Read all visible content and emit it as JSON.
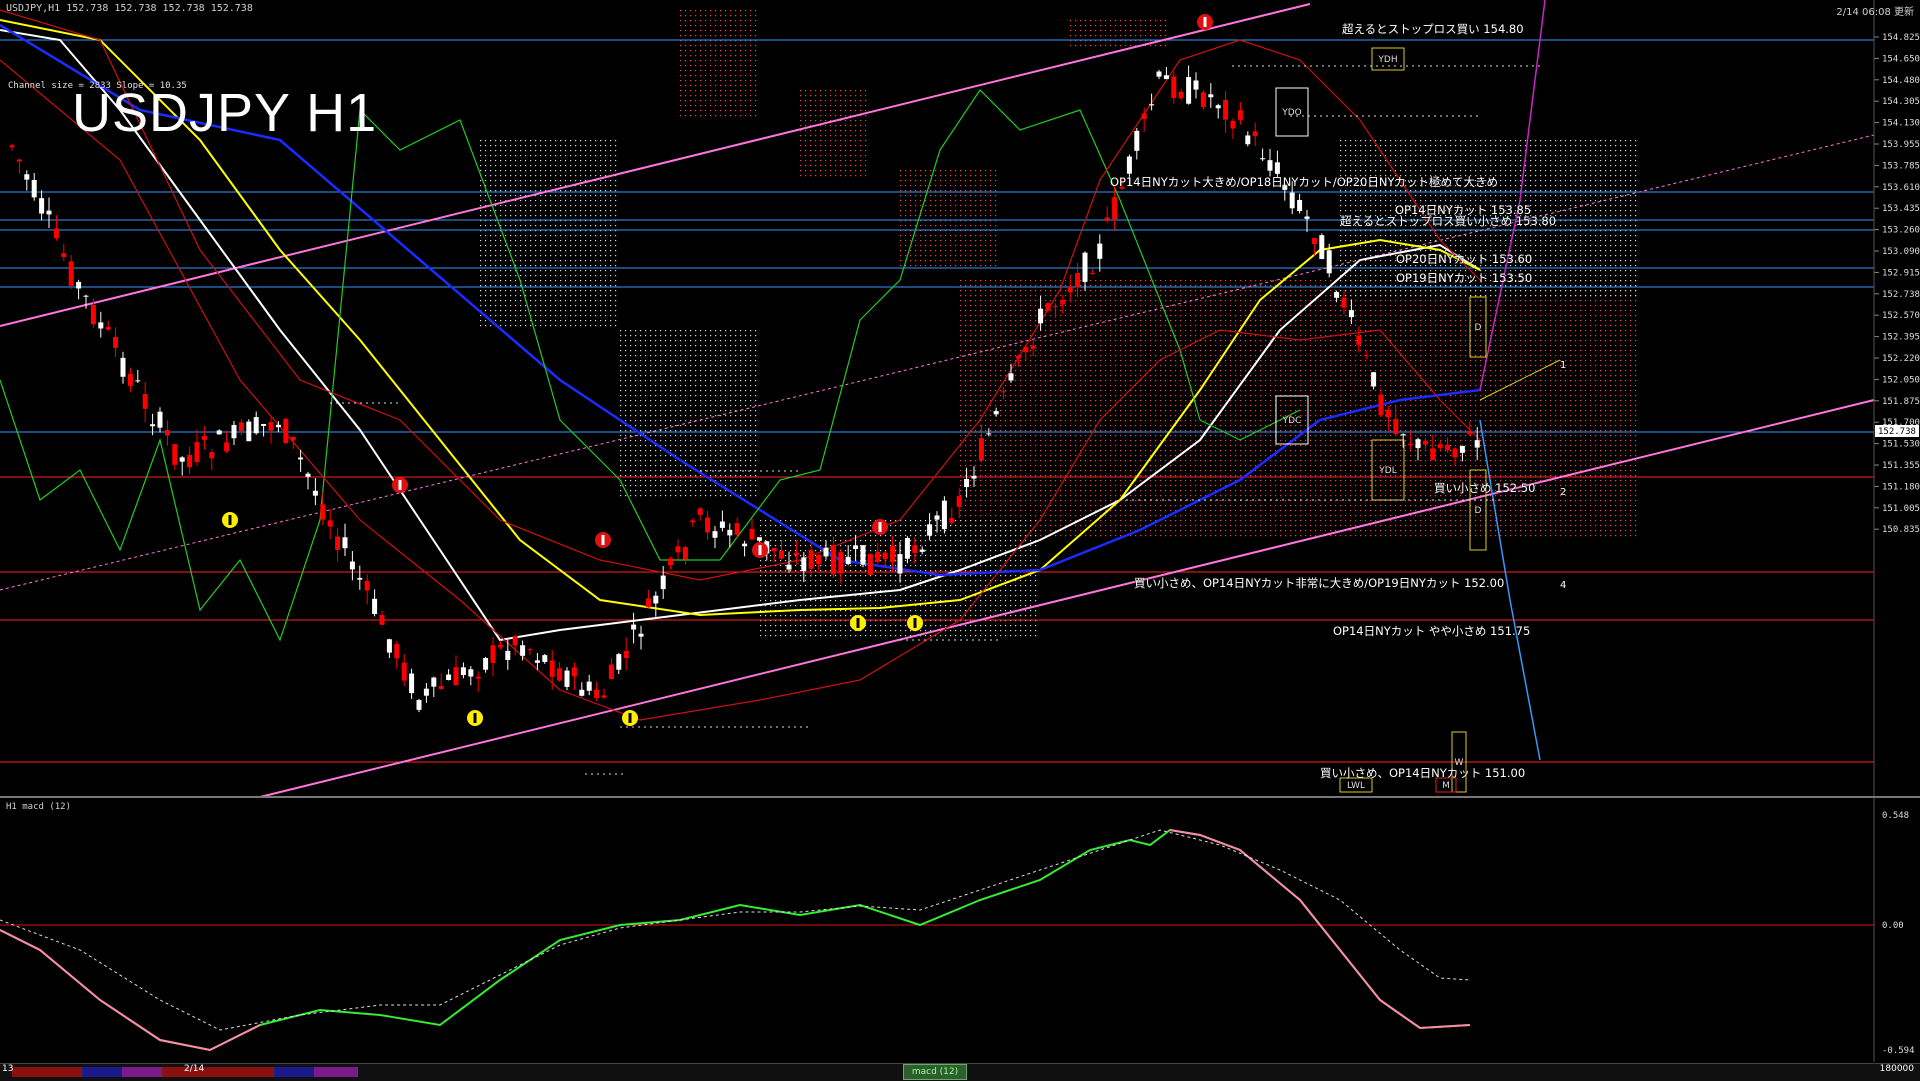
{
  "header": {
    "symbol_info": "USDJPY,H1 152.738 152.738 152.738 152.738",
    "timestamp": "2/14 06:08 更新"
  },
  "title": "USDJPY H1",
  "channel_info": "Channel size = 2833 Slope = 10.35",
  "macd_title": "H1  macd (12)",
  "price_axis": [
    "154.825",
    "154.650",
    "154.480",
    "154.305",
    "154.130",
    "153.955",
    "153.785",
    "153.610",
    "153.435",
    "153.260",
    "153.090",
    "152.915",
    "152.738",
    "152.570",
    "152.395",
    "152.220",
    "152.050",
    "151.875",
    "151.700",
    "151.530",
    "151.355",
    "151.180",
    "151.005",
    "150.835"
  ],
  "current_price": "152.738",
  "macd_axis": [
    "0.548",
    "0.00",
    "-0.594"
  ],
  "annotations": {
    "a1": "超えるとストップロス買い 154.80",
    "a2": "OP14日NYカット大きめ/OP18日NYカット/OP20日NYカット極めて大きめ",
    "a3": "OP14日NYカット 153.85",
    "a4": "超えるとストップロス買い小さめ 153.80",
    "a5": "OP20日NYカット 153.60",
    "a6": "OP19日NYカット 153.50",
    "a7": "買い小さめ 152.50",
    "a8": "買い小さめ、OP14日NYカット非常に大きめ/OP19日NYカット 152.00",
    "a9": "OP14日NYカット やや小さめ 151.75",
    "a10": "買い小さめ、OP14日NYカット 151.00"
  },
  "box_labels": {
    "ydh": "YDH",
    "ydo": "YDO",
    "ydc": "YDC",
    "ydl": "YDL",
    "lwl": "LWL",
    "d1": "D",
    "d2": "D",
    "w": "W",
    "m": "M",
    "n1": "1",
    "n2": "2",
    "n4": "4"
  },
  "bottom": {
    "left": "13",
    "mid": "2/14",
    "macd_tab": "macd (12)",
    "right": "180000"
  },
  "colors": {
    "bg": "#000000",
    "bull_candle": "#ffffff",
    "bear_candle": "#ff0000",
    "sma_white": "#ffffff",
    "sma_yellow": "#ffff00",
    "sma_blue": "#1a2cff",
    "green_line": "#22cc22",
    "cloud_red": "#ff4040",
    "cloud_white": "#dddddd",
    "channel_pink": "#ff77dd",
    "hline_blue": "#3399ff",
    "hline_red": "#ff2222",
    "macd_green": "#33ee33",
    "macd_pink": "#ff88aa"
  }
}
